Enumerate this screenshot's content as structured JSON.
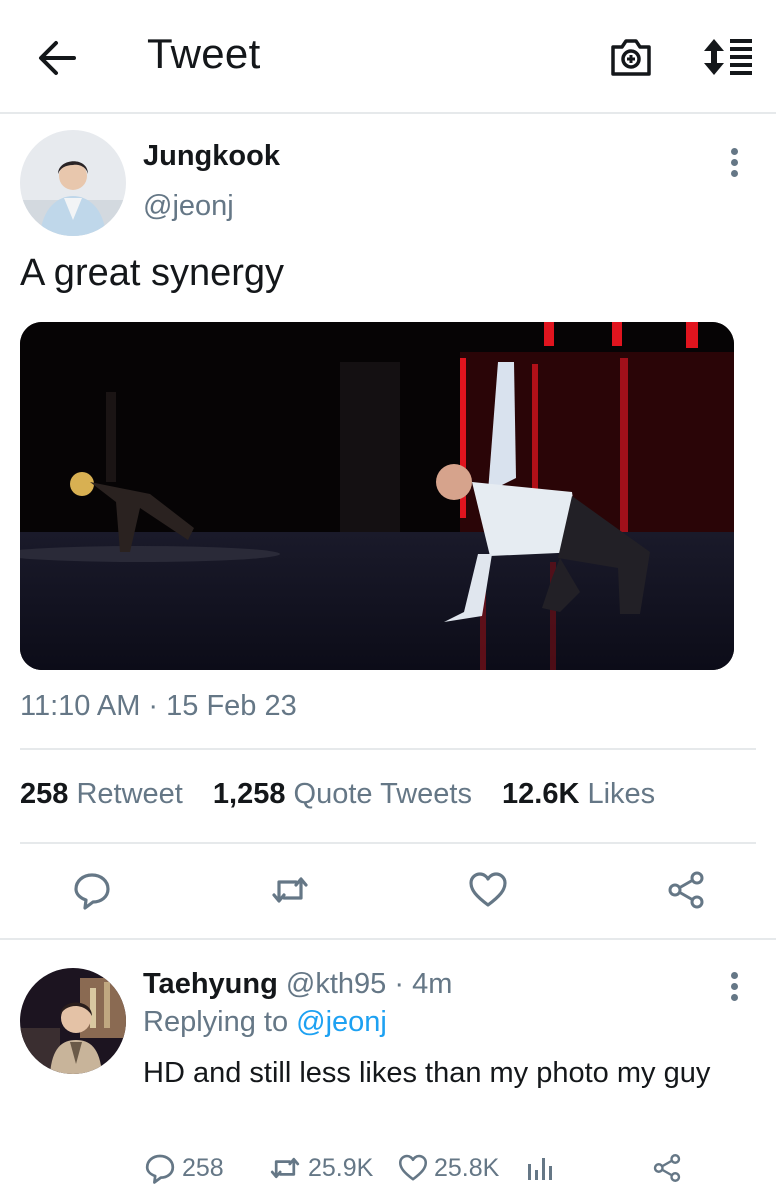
{
  "header": {
    "title": "Tweet",
    "back_icon": "arrow-left-icon",
    "camera_icon": "camera-plus-icon",
    "sort_icon": "sort-lines-icon"
  },
  "tweet": {
    "author_name": "Jungkook",
    "author_handle": "@jeonj",
    "text": "A great synergy",
    "time": "11:10 AM · 15 Feb 23",
    "stats": {
      "retweets": "258",
      "retweets_label": "Retweet",
      "quotes": "1,258",
      "quotes_label": "Quote Tweets",
      "likes": "12.6K",
      "likes_label": "Likes"
    },
    "actions": [
      "reply-icon",
      "retweet-icon",
      "like-icon",
      "share-icon"
    ]
  },
  "reply": {
    "author_name": "Taehyung",
    "author_handle": "@kth95",
    "time_ago": "4m",
    "replying_prefix": "Replying to",
    "replying_to": "@jeonj",
    "text": "HD and still less likes than my photo my guy",
    "counts": {
      "replies": "258",
      "retweets": "25.9K",
      "likes": "25.8K"
    }
  },
  "colors": {
    "primary_text": "#14171a",
    "secondary_text": "#657786",
    "accent": "#1da1f2",
    "divider": "#e6e9eb"
  }
}
